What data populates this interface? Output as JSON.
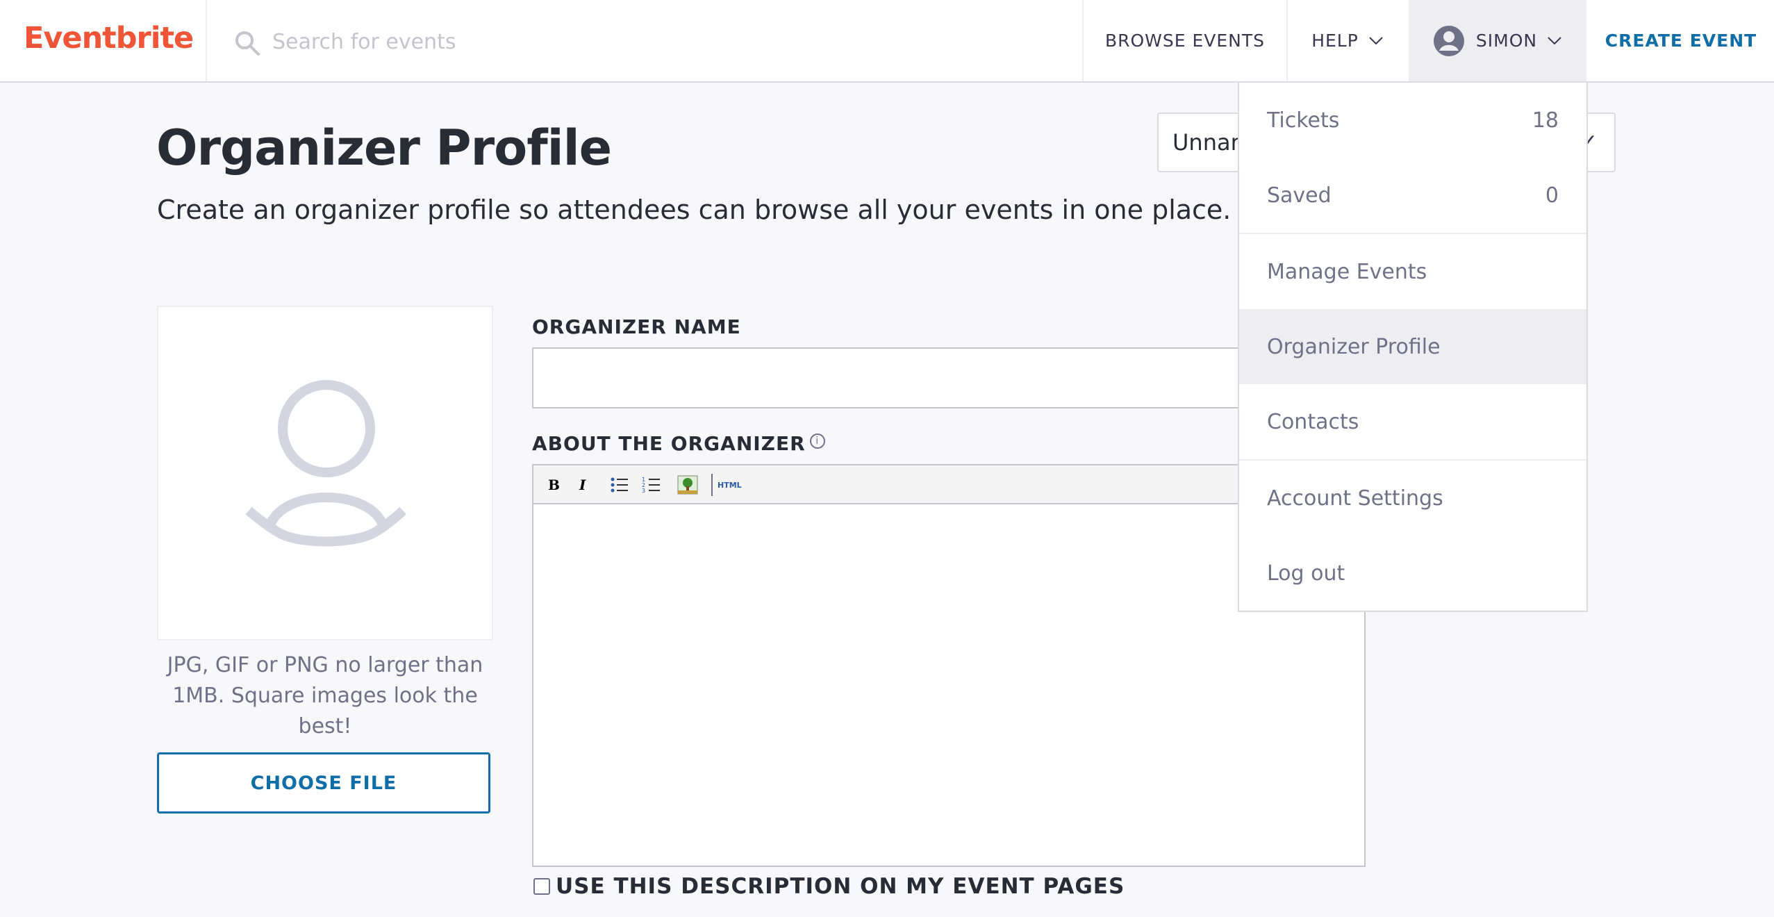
{
  "header": {
    "logo": "Eventbrite",
    "search_placeholder": "Search for events",
    "browse_label": "BROWSE EVENTS",
    "help_label": "HELP",
    "user_label": "SIMON",
    "create_label": "CREATE EVENT"
  },
  "page": {
    "title": "Organizer Profile",
    "subtitle": "Create an organizer profile so attendees can browse all your events in one place.",
    "profile_select_value": "Unnar"
  },
  "image_upload": {
    "hint": "JPG, GIF or PNG no larger than 1MB. Square images look the best!",
    "button_label": "CHOOSE FILE"
  },
  "form": {
    "name_label": "ORGANIZER NAME",
    "name_value": "",
    "about_label": "ABOUT THE ORGANIZER",
    "info_glyph": "i",
    "toolbar": [
      "bold-icon",
      "italic-icon",
      "bulleted-list-icon",
      "numbered-list-icon",
      "insert-image-icon",
      "html-icon"
    ],
    "use_description_label": "USE THIS DESCRIPTION ON MY EVENT PAGES",
    "use_description_checked": false
  },
  "user_menu": {
    "items": [
      {
        "label": "Tickets",
        "count": "18"
      },
      {
        "label": "Saved",
        "count": "0"
      },
      {
        "label": "Manage Events"
      },
      {
        "label": "Organizer Profile",
        "active": true
      },
      {
        "label": "Contacts"
      },
      {
        "label": "Account Settings"
      },
      {
        "label": "Log out"
      }
    ]
  },
  "colors": {
    "brand": "#f05537",
    "link": "#0f6ea8",
    "text": "#282c35",
    "muted": "#6f7287",
    "background": "#f8f7fa"
  }
}
